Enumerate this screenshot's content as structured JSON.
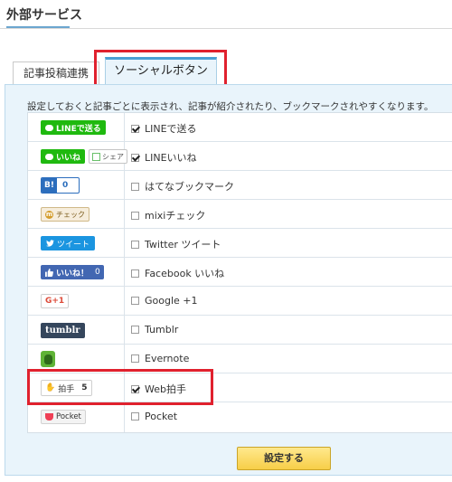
{
  "page": {
    "title": "外部サービス"
  },
  "tabs": [
    {
      "label": "記事投稿連携",
      "active": false
    },
    {
      "label": "ソーシャルボタン",
      "active": true
    }
  ],
  "description": "設定しておくと記事ごとに表示され、記事が紹介されたり、ブックマークされやすくなります。",
  "rows": [
    {
      "button": {
        "icon": "line-icon",
        "text": "LINEで送る"
      },
      "label": "LINEで送る",
      "checked": true
    },
    {
      "button": {
        "icon": "line-icon",
        "text": "いいね",
        "share_text": "シェア"
      },
      "label": "LINEいいね",
      "checked": true
    },
    {
      "button": {
        "icon": "hatena-bookmark-icon",
        "text": "B!",
        "count": "0"
      },
      "label": "はてなブックマーク",
      "checked": false
    },
    {
      "button": {
        "icon": "mixi-icon",
        "text": "チェック"
      },
      "label": "mixiチェック",
      "checked": false
    },
    {
      "button": {
        "icon": "twitter-icon",
        "text": "ツイート"
      },
      "label": "Twitter ツイート",
      "checked": false
    },
    {
      "button": {
        "icon": "facebook-like-icon",
        "text": "いいね！",
        "count": "0"
      },
      "label": "Facebook いいね",
      "checked": false
    },
    {
      "button": {
        "icon": "google-plus-icon",
        "text": "G+1"
      },
      "label": "Google +1",
      "checked": false
    },
    {
      "button": {
        "icon": "tumblr-icon",
        "text": "tumblr"
      },
      "label": "Tumblr",
      "checked": false
    },
    {
      "button": {
        "icon": "evernote-icon"
      },
      "label": "Evernote",
      "checked": false
    },
    {
      "button": {
        "icon": "clap-icon",
        "text": "拍手",
        "count": "5"
      },
      "label": "Web拍手",
      "checked": true
    },
    {
      "button": {
        "icon": "pocket-icon",
        "text": "Pocket"
      },
      "label": "Pocket",
      "checked": false
    }
  ],
  "submit": {
    "label": "設定する"
  },
  "colors": {
    "accent": "#4ba0d4",
    "panel_bg": "#e9f4fb",
    "highlight": "#e0212e",
    "submit_bg": "#f7ce48",
    "line_green": "#1fb90f",
    "twitter_blue": "#1b95e0",
    "facebook_blue": "#4267b2"
  }
}
